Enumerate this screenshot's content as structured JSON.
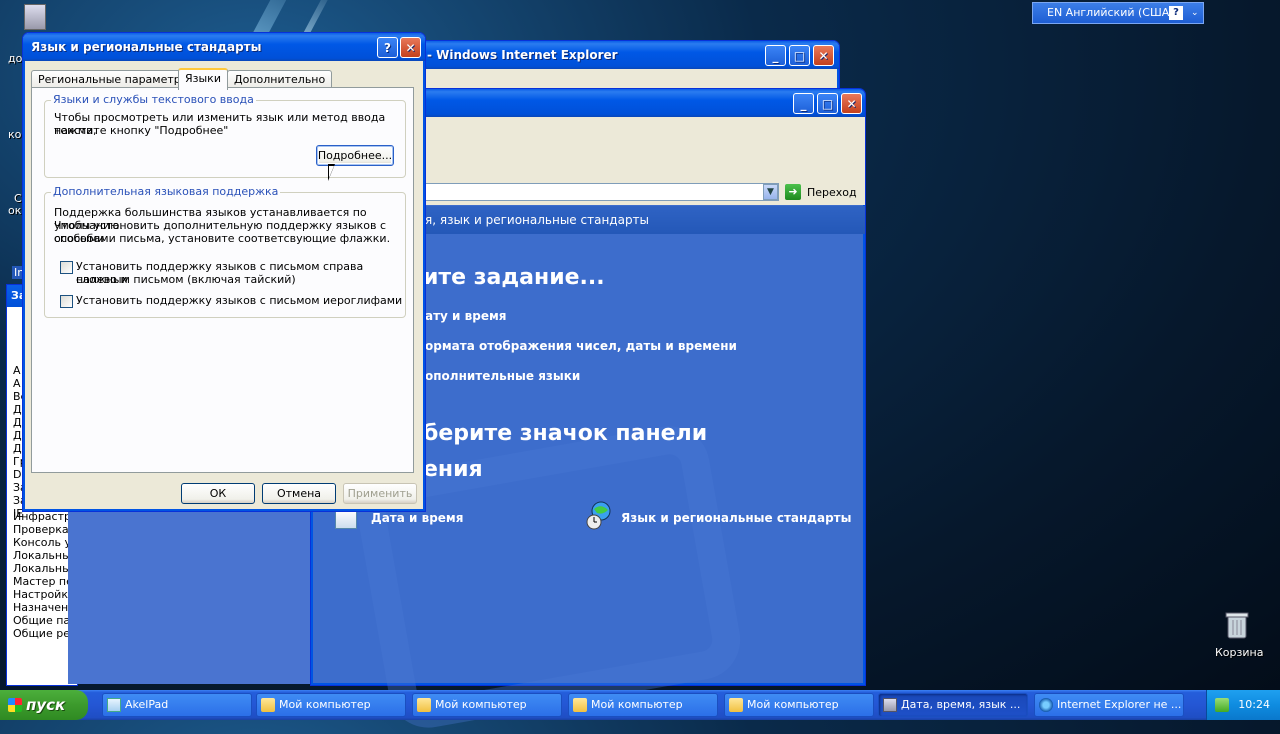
{
  "desktop": {
    "labels_left": [
      "до",
      "ко",
      "С",
      "ок"
    ],
    "recycle_bin": "Корзина"
  },
  "language_bar": {
    "label": "EN Английский (США)",
    "help": "?",
    "arrow": "⌄"
  },
  "ie_window": {
    "title": "- Windows Internet Explorer"
  },
  "control_panel": {
    "toolbar_fragment": ".",
    "go_label": "Переход",
    "breadcrumb": "я, язык и региональные стандарты",
    "heading_task": "ите задание...",
    "tasks": [
      "ату и время",
      "ормата отображения чисел, даты и времени",
      "ополнительные языки"
    ],
    "heading_icon_line1": "берите значок панели",
    "heading_icon_line2": "ения",
    "icons": {
      "datetime": "Дата и время",
      "regional": "Язык и региональные стандарты"
    }
  },
  "left_window": {
    "title_fragment": "За",
    "top_fragment": "In",
    "items": [
      "А",
      "А",
      "Ве",
      "Д",
      "Д",
      "Д",
      "Д",
      "Гр",
      "DI",
      "За",
      "За",
      "IE",
      "Инфрастр",
      "Проверка",
      "Консоль у",
      "Локальны",
      "Локальны",
      "Мастер пе",
      "Настройка",
      "Назначени",
      "Общие па",
      "Общие ре"
    ]
  },
  "dialog": {
    "title": "Язык и региональные стандарты",
    "tabs": [
      "Региональные параметры",
      "Языки",
      "Дополнительно"
    ],
    "active_tab": "Языки",
    "group1": {
      "title": "Языки и службы текстового ввода",
      "text_line1": "Чтобы просмотреть или изменить язык или метод ввода текста,",
      "text_line2": "нажмите кнопку \"Подробнее\"",
      "button": "Подробнее..."
    },
    "group2": {
      "title": "Дополнительная языковая поддержка",
      "text_line1": "Поддержка большинства языков устанавливается по умолчанию.",
      "text_line2": "Чтобы установить дополнительную поддержку языков с особыми",
      "text_line3": "способами письма, установите соответсвующие флажки.",
      "checkbox1_line1": "Установить поддержку языков с письмом справа налево и",
      "checkbox1_line2": "сложным письмом (включая тайский)",
      "checkbox2": "Установить поддержку языков с письмом иероглифами",
      "checkbox1_checked": false,
      "checkbox2_checked": false
    },
    "ok": "ОК",
    "cancel": "Отмена",
    "apply": "Применить"
  },
  "taskbar": {
    "start": "пуск",
    "tasks": [
      {
        "label": "AkelPad",
        "icon": "notepad-icon"
      },
      {
        "label": "Мой компьютер",
        "icon": "folder-icon"
      },
      {
        "label": "Мой компьютер",
        "icon": "folder-icon"
      },
      {
        "label": "Мой компьютер",
        "icon": "folder-icon"
      },
      {
        "label": "Мой компьютер",
        "icon": "folder-icon"
      },
      {
        "label": "Дата, время, язык ...",
        "icon": "control-panel-icon"
      },
      {
        "label": "Internet Explorer не ...",
        "icon": "ie-icon"
      }
    ],
    "clock": "10:24"
  }
}
